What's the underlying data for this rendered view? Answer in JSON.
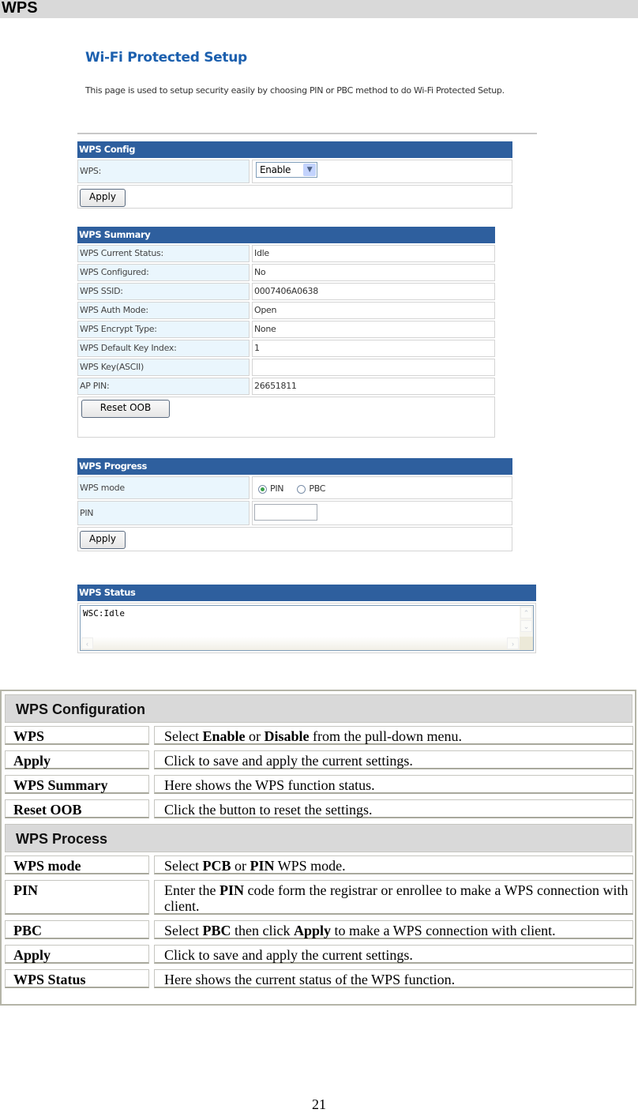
{
  "section_title": "WPS",
  "router_ui": {
    "title": "Wi-Fi Protected Setup",
    "description": "This page is used to setup security easily by choosing PIN or PBC method to do Wi-Fi Protected Setup.",
    "wps_config": {
      "header": "WPS Config",
      "wps_label": "WPS:",
      "wps_select_value": "Enable",
      "apply_label": "Apply"
    },
    "wps_summary": {
      "header": "WPS Summary",
      "rows": [
        {
          "label": "WPS Current Status:",
          "value": "Idle"
        },
        {
          "label": "WPS Configured:",
          "value": "No"
        },
        {
          "label": "WPS SSID:",
          "value": "0007406A0638"
        },
        {
          "label": "WPS Auth Mode:",
          "value": "Open"
        },
        {
          "label": "WPS Encrypt Type:",
          "value": "None"
        },
        {
          "label": "WPS Default Key Index:",
          "value": "1"
        },
        {
          "label": "WPS Key(ASCII)",
          "value": ""
        },
        {
          "label": "AP PIN:",
          "value": "26651811"
        }
      ],
      "reset_label": "Reset OOB"
    },
    "wps_progress": {
      "header": "WPS Progress",
      "mode_label": "WPS mode",
      "mode_options": [
        "PIN",
        "PBC"
      ],
      "mode_selected": "PIN",
      "pin_label": "PIN",
      "pin_value": "",
      "apply_label": "Apply"
    },
    "wps_status": {
      "header": "WPS Status",
      "text": "WSC:Idle"
    }
  },
  "reference_table": {
    "sections": [
      {
        "title": "WPS Configuration",
        "rows": [
          {
            "term": "WPS",
            "desc": [
              {
                "t": "Select "
              },
              {
                "b": "Enable"
              },
              {
                "t": " or "
              },
              {
                "b": "Disable"
              },
              {
                "t": " from the pull-down menu."
              }
            ]
          },
          {
            "term": "Apply",
            "desc": [
              {
                "t": "Click to save and apply the current settings."
              }
            ]
          },
          {
            "term": "WPS Summary",
            "desc": [
              {
                "t": "Here shows the WPS function status."
              }
            ]
          },
          {
            "term": "Reset OOB",
            "desc": [
              {
                "t": "Click the button to reset the settings."
              }
            ]
          }
        ]
      },
      {
        "title": "WPS Process",
        "rows": [
          {
            "term": "WPS mode",
            "desc": [
              {
                "t": "Select "
              },
              {
                "b": "PCB"
              },
              {
                "t": " or "
              },
              {
                "b": "PIN"
              },
              {
                "t": " WPS mode."
              }
            ]
          },
          {
            "term": "PIN",
            "desc": [
              {
                "t": "Enter the "
              },
              {
                "b": "PIN"
              },
              {
                "t": " code form the registrar or enrollee to make a WPS connection with client."
              }
            ]
          },
          {
            "term": "PBC",
            "desc": [
              {
                "t": "Select "
              },
              {
                "b": "PBC"
              },
              {
                "t": " then click "
              },
              {
                "b": "Apply"
              },
              {
                "t": " to make a WPS connection with client."
              }
            ]
          },
          {
            "term": "Apply",
            "desc": [
              {
                "t": "Click to save and apply the current settings."
              }
            ]
          },
          {
            "term": "WPS Status",
            "desc": [
              {
                "t": "Here shows the current status of the WPS function."
              }
            ]
          }
        ]
      }
    ]
  },
  "page_number": "21"
}
